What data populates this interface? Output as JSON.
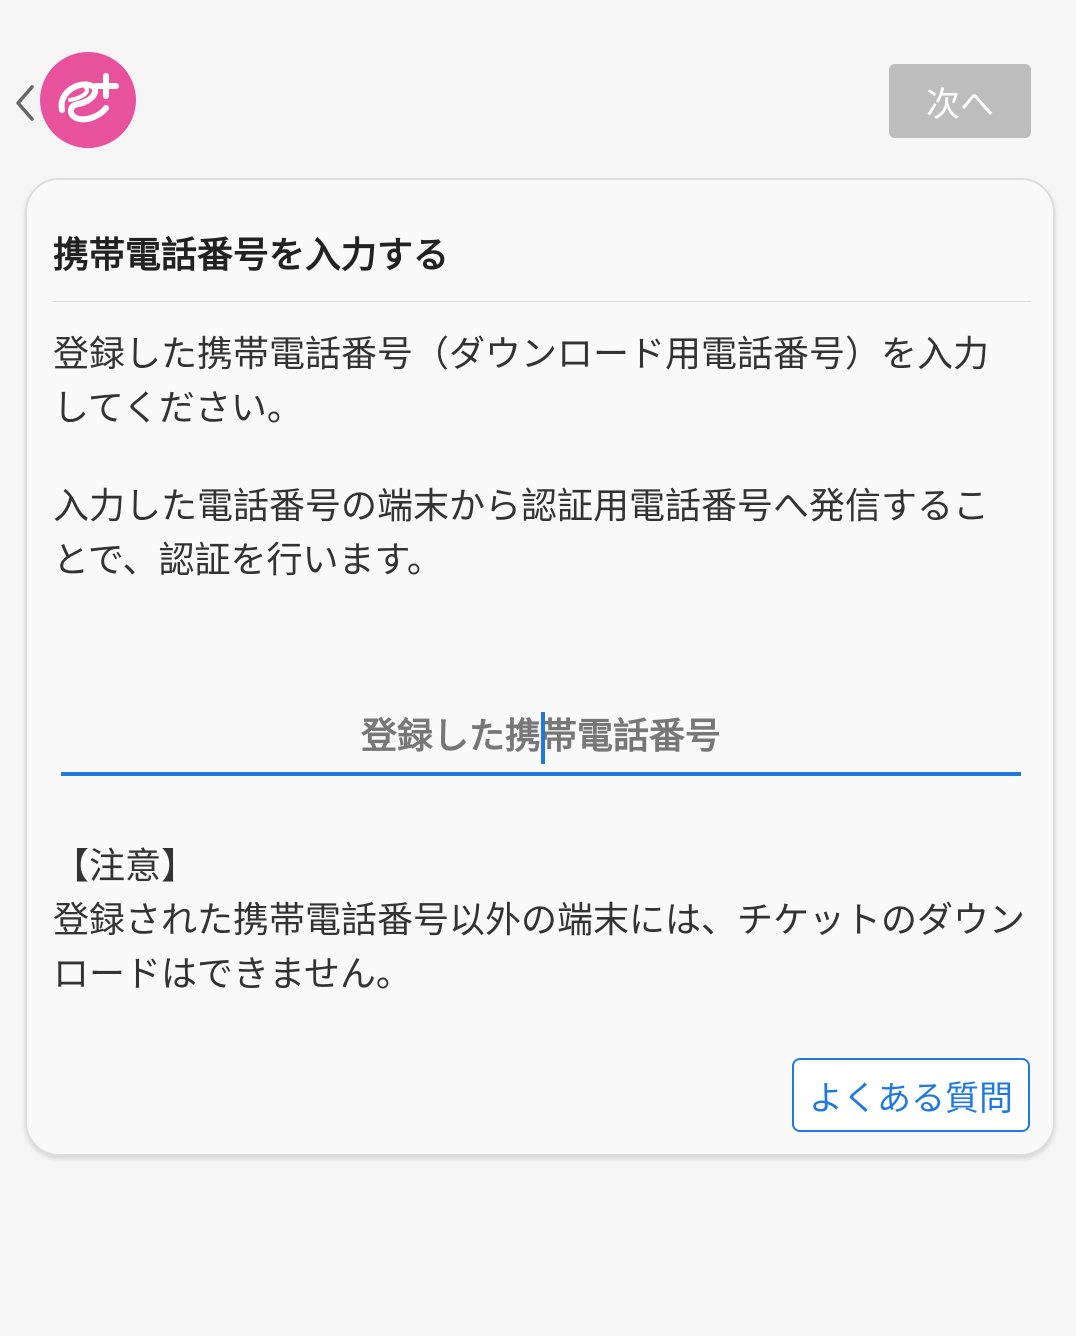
{
  "header": {
    "back_icon": "chevron-left-icon",
    "logo_icon": "eplus-logo-icon",
    "next_label": "次へ"
  },
  "colors": {
    "logo": "#e8529d",
    "accent": "#1f7ae0",
    "disabled_button": "#bdbdbd"
  },
  "card": {
    "title": "携帯電話番号を入力する",
    "paragraph1": "登録した携帯電話番号（ダウンロード用電話番号）を入力してください。",
    "paragraph2": "入力した電話番号の端末から認証用電話番号へ発信することで、認証を行います。",
    "phone_input": {
      "placeholder": "登録した携帯電話番号",
      "value": ""
    },
    "notice_heading": "【注意】",
    "notice_text": "登録された携帯電話番号以外の端末には、チケットのダウンロードはできません。",
    "faq_label": "よくある質問"
  }
}
